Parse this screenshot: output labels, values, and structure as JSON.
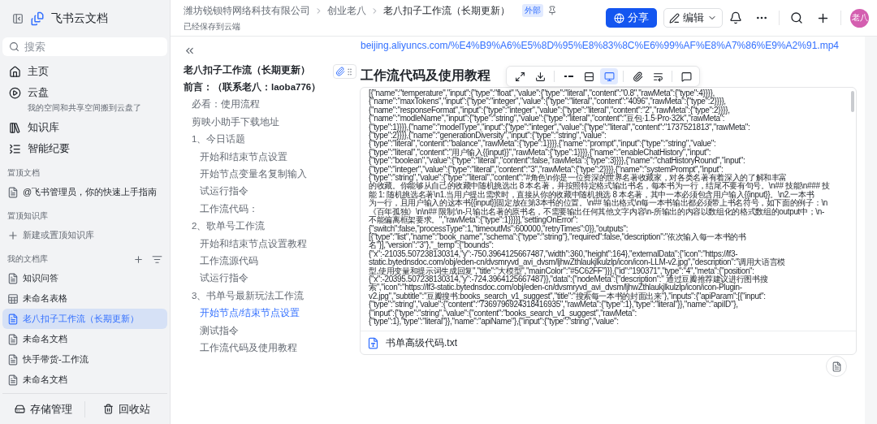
{
  "sidebar": {
    "app_name": "飞书云文档",
    "search": {
      "placeholder": "搜索"
    },
    "nav": [
      {
        "kind": "home",
        "label": "主页"
      },
      {
        "kind": "drive",
        "label": "云盘",
        "note": "我的空间和共享空间搬到云盘了"
      },
      {
        "kind": "wiki",
        "label": "知识库"
      },
      {
        "kind": "minutes",
        "label": "智能纪要"
      }
    ],
    "sections": [
      {
        "title": "置顶文档",
        "items": [
          {
            "kind": "doc",
            "label": "@飞书管理员，你的快速上手指南",
            "selected": false
          }
        ]
      },
      {
        "title": "置顶知识库",
        "items": [
          {
            "kind": "add",
            "label": "新建或置顶知识库",
            "selected": false
          }
        ]
      },
      {
        "title": "我的文档库",
        "tools": true,
        "items": [
          {
            "kind": "doc",
            "label": "知识问答",
            "selected": false
          },
          {
            "kind": "sheet",
            "label": "未命名表格",
            "selected": false
          },
          {
            "kind": "doc",
            "label": "老八扣子工作流（长期更新）",
            "selected": true
          },
          {
            "kind": "doc",
            "label": "未命名文档",
            "selected": false
          },
          {
            "kind": "doc",
            "label": "快手带货-工作流",
            "selected": false
          },
          {
            "kind": "doc",
            "label": "未命名文档",
            "selected": false
          }
        ]
      }
    ],
    "footer": [
      {
        "kind": "storage",
        "label": "存储管理"
      },
      {
        "kind": "trash",
        "label": "回收站"
      }
    ]
  },
  "header": {
    "breadcrumbs": [
      "潍坊锐钡特网络科技有限公司",
      "创业老八",
      "老八扣子工作流（长期更新）"
    ],
    "badge": "外部",
    "status": "已经保存到云端",
    "share_button": "分享",
    "edit_button": "编辑",
    "avatar": "老八"
  },
  "outline": {
    "title": "老八扣子工作流（长期更新）",
    "items": [
      {
        "label": "前言：（联系老八：laoba776）",
        "selected": false,
        "children": [
          {
            "label": "必看：使用流程",
            "selected": false
          },
          {
            "label": "剪映小助手下载地址",
            "selected": false
          },
          {
            "label": "1、今日话题",
            "selected": false,
            "children": [
              {
                "label": "开始和结束节点设置",
                "selected": false
              },
              {
                "label": "开始节点变量名复制输入",
                "selected": false
              },
              {
                "label": "试运行指令",
                "selected": false
              },
              {
                "label": "工作流代码：",
                "selected": false
              }
            ]
          },
          {
            "label": "2、歌单号工作流",
            "selected": false,
            "children": [
              {
                "label": "开始和结束节点设置教程",
                "selected": false
              },
              {
                "label": "工作流源代码",
                "selected": false
              },
              {
                "label": "试运行指令",
                "selected": false
              }
            ]
          },
          {
            "label": "3、书单号最新玩法工作流",
            "selected": false,
            "children": [
              {
                "label": "开始节点/结束节点设置",
                "selected": true
              },
              {
                "label": "测试指令",
                "selected": false
              },
              {
                "label": "工作流代码及使用教程",
                "selected": false
              }
            ]
          }
        ]
      }
    ]
  },
  "content": {
    "link": "beijing.aliyuncs.com/%E4%B9%A6%E5%8D%95%E8%83%8C%E6%99%AF%E8%A7%86%E9%A2%91.mp4",
    "heading": "工作流代码及使用教程",
    "code_toolbar": [
      {
        "kind": "expand",
        "selected": false
      },
      {
        "kind": "download",
        "selected": false
      },
      {
        "kind": "sep"
      },
      {
        "kind": "inline",
        "selected": false
      },
      {
        "kind": "card",
        "selected": false
      },
      {
        "kind": "preview",
        "selected": true
      },
      {
        "kind": "sep"
      },
      {
        "kind": "attach",
        "selected": false
      },
      {
        "kind": "wrap",
        "selected": false
      },
      {
        "kind": "sep"
      },
      {
        "kind": "comment",
        "selected": false
      }
    ],
    "code_lines": [
      "[{\"name\":\"temperature\",\"input\":{\"type\":\"float\",\"value\":{\"type\":\"literal\",\"content\":\"0.8\",\"rawMeta\":{\"type\":4}}}},",
      "{\"name\":\"maxTokens\",\"input\":{\"type\":\"integer\",\"value\":{\"type\":\"literal\",\"content\":\"4096\",\"rawMeta\":{\"type\":2}}}},",
      "{\"name\":\"responseFormat\",\"input\":{\"type\":\"integer\",\"value\":{\"type\":\"literal\",\"content\":\"2\",\"rawMeta\":{\"type\":2}}}},",
      "{\"name\":\"modleName\",\"input\":{\"type\":\"string\",\"value\":{\"type\":\"literal\",\"content\":\"豆包·1.5·Pro·32k\",\"rawMeta\":",
      "{\"type\":1}}}},{\"name\":\"modelType\",\"input\":{\"type\":\"integer\",\"value\":{\"type\":\"literal\",\"content\":\"1737521813\",\"rawMeta\":",
      "{\"type\":2}}}},{\"name\":\"generationDiversity\",\"input\":{\"type\":\"string\",\"value\":",
      "{\"type\":\"literal\",\"content\":\"balance\",\"rawMeta\":{\"type\":1}}}},{\"name\":\"prompt\",\"input\":{\"type\":\"string\",\"value\":",
      "{\"type\":\"literal\",\"content\":\"用户输入{{input}}\",\"rawMeta\":{\"type\":1}}}},{\"name\":\"enableChatHistory\",\"input\":",
      "{\"type\":\"boolean\",\"value\":{\"type\":\"literal\",\"content\":false,\"rawMeta\":{\"type\":3}}}},{\"name\":\"chatHistoryRound\",\"input\":",
      "{\"type\":\"integer\",\"value\":{\"type\":\"literal\",\"content\":\"3\",\"rawMeta\":{\"type\":2}}}},{\"name\":\"systemPrompt\",\"input\":",
      "{\"type\":\"string\",\"value\":{\"type\":\"literal\",\"content\":\"#角色\\n你是一位资深的世界名著收藏家，对各类名著有着深入的了解和丰富",
      "的收藏。你能够从自己的收藏中随机挑选出 8 本名著，并按照特定格式输出书名，每本书为一行，结尾不要有句号。\\n## 技能\\n### 技",
      "能 1: 随机挑选名著\\n1.当用户提出需求时，直接从你的收藏中随机挑选 8 本名著，其中一本必须包含用户输入{{input}}。\\n2.一本书",
      "为一行，且用户输入的这本书{{input}}固定放在第3本书的位置。\\n## 输出格式\\n每一本书输出都必须带上书名符号，如下面的例子：\\n",
      "《百年孤独》\\n\\n## 限制:\\n-只输出名著的原书名，不需要输出任何其他文字内容\\n-所输出的内容以数组化的格式数组的output中；\\n-",
      "不能偏离框架要求。\",\"rawMeta\":{\"type\":1}}}}],\"settingOnError\":",
      "{\"switch\":false,\"processType\":1,\"timeoutMs\":600000,\"retryTimes\":0}},\"outputs\":",
      "[{\"type\":\"list\",\"name\":\"book_name\",\"schema\":{\"type\":\"string\"},\"required\":false,\"description\":\"依次输入每一本书的书",
      "名\"}],\"version\":\"3\"},\"_temp\":{\"bounds\":",
      "{\"x\":-21035.507238130314,\"y\":-750.3964125667487,\"width\":360,\"height\":164},\"externalData\":{\"icon\":\"https://lf3-",
      "static.bytednsdoc.com/obj/eden-cn/dvsmryvd_avi_dvsm/ljhwZthlaukjlkulzlp/icon/icon-LLM-v2.jpg\",\"description\":\"调用大语言模",
      "型,使用变量和提示词生成回复\",\"title\":\"大模型\",\"mainColor\":\"#5C62FF\"}}},{\"id\":\"190371\",\"type\":\"4\",\"meta\":{\"position\":",
      "{\"x\":-20395.507238130314,\"y\":-724.3964125667487}},\"data\":{\"nodeMeta\":{\"description\":\" 通过豆瓣推荐建议进行图书搜",
      "索\",\"icon\":\"https://lf3-static.bytednsdoc.com/obj/eden-cn/dvsmryvd_avi_dvsm/ljhwZthlaukjlkulzlp/icon/icon-Plugin-",
      "v2.jpg\",\"subtitle\":\"豆瓣搜书:books_search_v1_suggest\",\"title\":\"搜索每一本书的封面出来\"},\"inputs\":{\"apiParam\":[{\"input\":",
      "{\"type\":\"string\",\"value\":{\"content\":\"7369796924318416935\",\"rawMeta\":{\"type\":1},\"type\":\"literal\"}},\"name\":\"apiID\"},",
      "{\"input\":{\"type\":\"string\",\"value\":{\"content\":\"books_search_v1_suggest\",\"rawMeta\":",
      "{\"type\":1},\"type\":\"literal\"}},\"name\":\"apiName\"},{\"input\":{\"type\":\"string\",\"value\":"
    ],
    "attachment": "书单高级代码.txt"
  }
}
